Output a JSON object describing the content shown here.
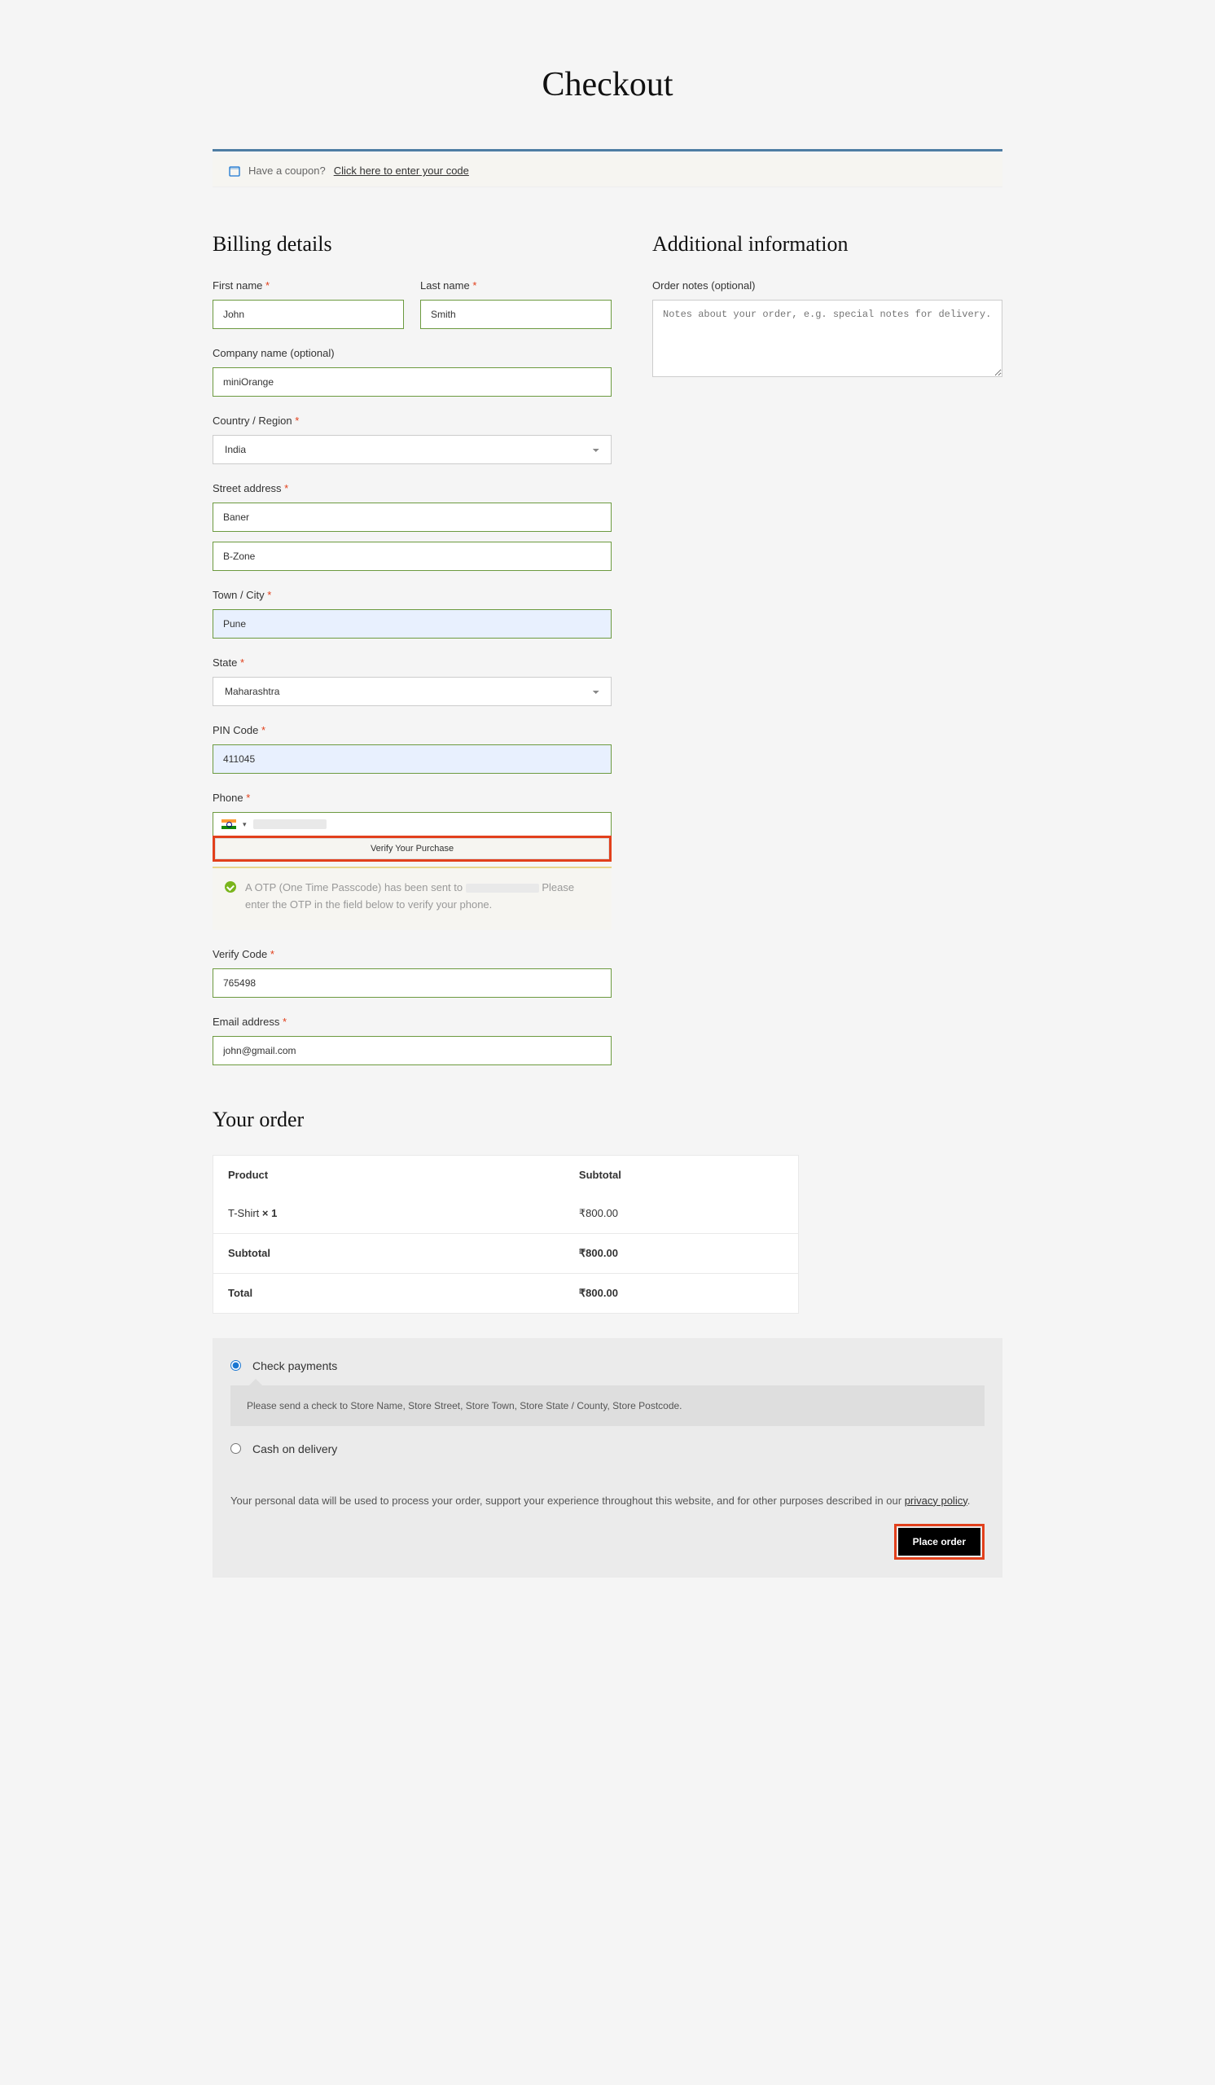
{
  "page": {
    "title": "Checkout"
  },
  "coupon": {
    "prompt": "Have a coupon? ",
    "link_text": "Click here to enter your code"
  },
  "billing": {
    "heading": "Billing details",
    "first_name_label": "First name",
    "first_name": "John",
    "last_name_label": "Last name",
    "last_name": "Smith",
    "company_label": "Company name (optional)",
    "company": "miniOrange",
    "country_label": "Country / Region",
    "country": "India",
    "street_label": "Street address",
    "street1": "Baner",
    "street2": "B-Zone",
    "city_label": "Town / City",
    "city": "Pune",
    "state_label": "State",
    "state": "Maharashtra",
    "pin_label": "PIN Code",
    "pin": "411045",
    "phone_label": "Phone",
    "verify_btn": "Verify Your Purchase",
    "otp_note_a": "A OTP (One Time Passcode) has been sent to ",
    "otp_note_b": " Please enter the OTP in the field below to verify your phone.",
    "verify_code_label": "Verify Code",
    "verify_code": "765498",
    "email_label": "Email address",
    "email": "john@gmail.com"
  },
  "additional": {
    "heading": "Additional information",
    "notes_label": "Order notes (optional)",
    "notes_placeholder": "Notes about your order, e.g. special notes for delivery."
  },
  "order": {
    "heading": "Your order",
    "product_header": "Product",
    "subtotal_header": "Subtotal",
    "item_name": "T-Shirt  ",
    "item_qty": "× 1",
    "item_price": "₹800.00",
    "subtotal_label": "Subtotal",
    "subtotal_value": "₹800.00",
    "total_label": "Total",
    "total_value": "₹800.00"
  },
  "payment": {
    "check_label": "Check payments",
    "check_desc": "Please send a check to Store Name, Store Street, Store Town, Store State / County, Store Postcode.",
    "cod_label": "Cash on delivery",
    "privacy_text_a": "Your personal data will be used to process your order, support your experience throughout this website, and for other purposes described in our ",
    "privacy_link": "privacy policy",
    "privacy_text_b": ".",
    "place_order": "Place order"
  }
}
